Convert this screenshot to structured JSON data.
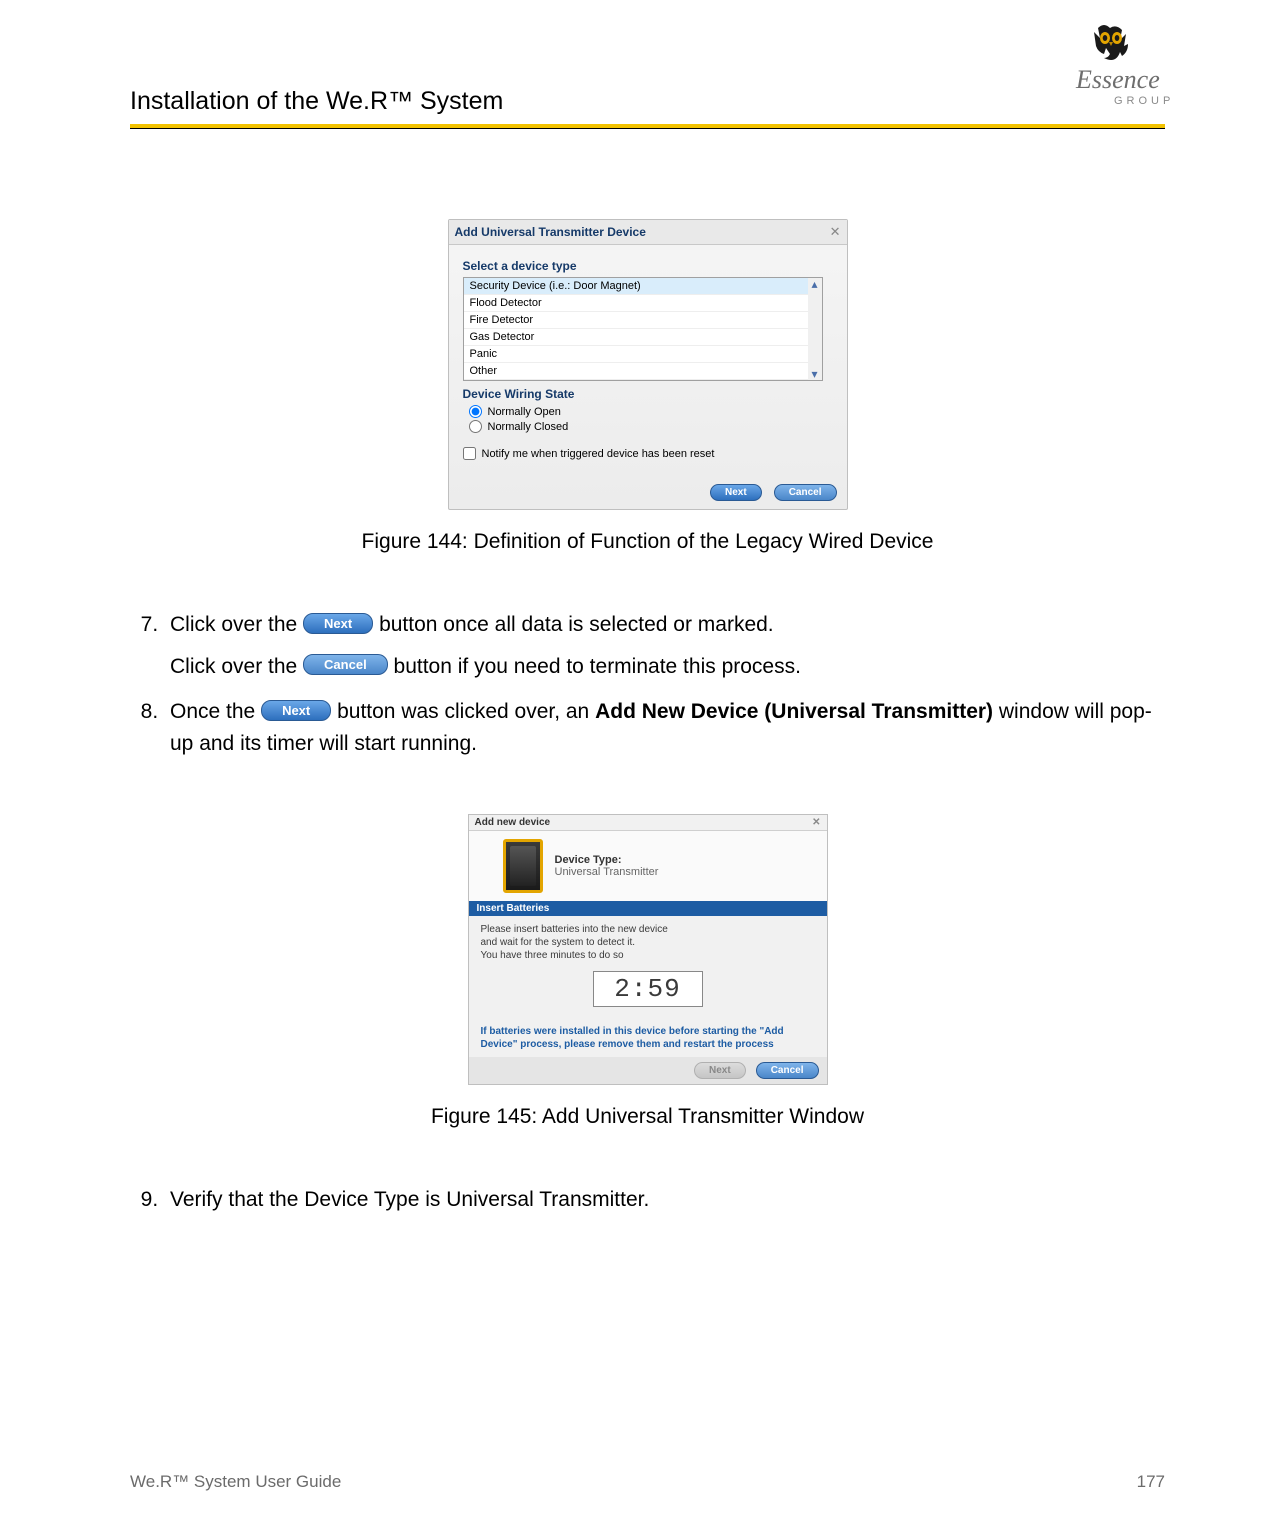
{
  "header": {
    "title": "Installation of the We.R™ System",
    "logo_brand": "Essence",
    "logo_sub": "GROUP"
  },
  "dialog144": {
    "title": "Add Universal Transmitter Device",
    "close_glyph": "✕",
    "section_device_type": "Select a device type",
    "device_types": [
      "Security Device (i.e.: Door Magnet)",
      "Flood Detector",
      "Fire Detector",
      "Gas Detector",
      "Panic",
      "Other"
    ],
    "section_wiring": "Device Wiring State",
    "radio_open": "Normally Open",
    "radio_closed": "Normally Closed",
    "notify_checkbox": "Notify me when triggered device has been reset",
    "btn_next": "Next",
    "btn_cancel": "Cancel"
  },
  "figure144_caption": "Figure 144: Definition of Function of the Legacy Wired Device",
  "steps_a": {
    "s7_before": "Click over the ",
    "s7_btn": "Next",
    "s7_after": " button once all data is selected or marked.",
    "s7b_before": "Click over the ",
    "s7b_btn": "Cancel",
    "s7b_after": " button if you need to terminate this process.",
    "s8_before": "Once the ",
    "s8_btn": "Next",
    "s8_mid": " button was clicked over, an ",
    "s8_bold": "Add New Device (Universal Transmitter)",
    "s8_after": " window will pop-up and its timer will start running."
  },
  "dialog145": {
    "title": "Add new device",
    "close_glyph": "✕",
    "device_type_label": "Device Type:",
    "device_type_value": "Universal Transmitter",
    "step_bar": "Insert Batteries",
    "line1": "Please insert batteries into the new device",
    "line2": "and wait for the system to detect it.",
    "line3": "You have three minutes to do so",
    "timer": "2:59",
    "note": "If batteries were installed in this device before starting the \"Add Device\" process, please remove them and restart the process",
    "btn_next": "Next",
    "btn_cancel": "Cancel"
  },
  "figure145_caption": "Figure 145: Add Universal Transmitter Window",
  "steps_b": {
    "s9": "Verify that the Device Type is Universal Transmitter."
  },
  "footer": {
    "left": "We.R™ System User Guide",
    "right": "177"
  }
}
